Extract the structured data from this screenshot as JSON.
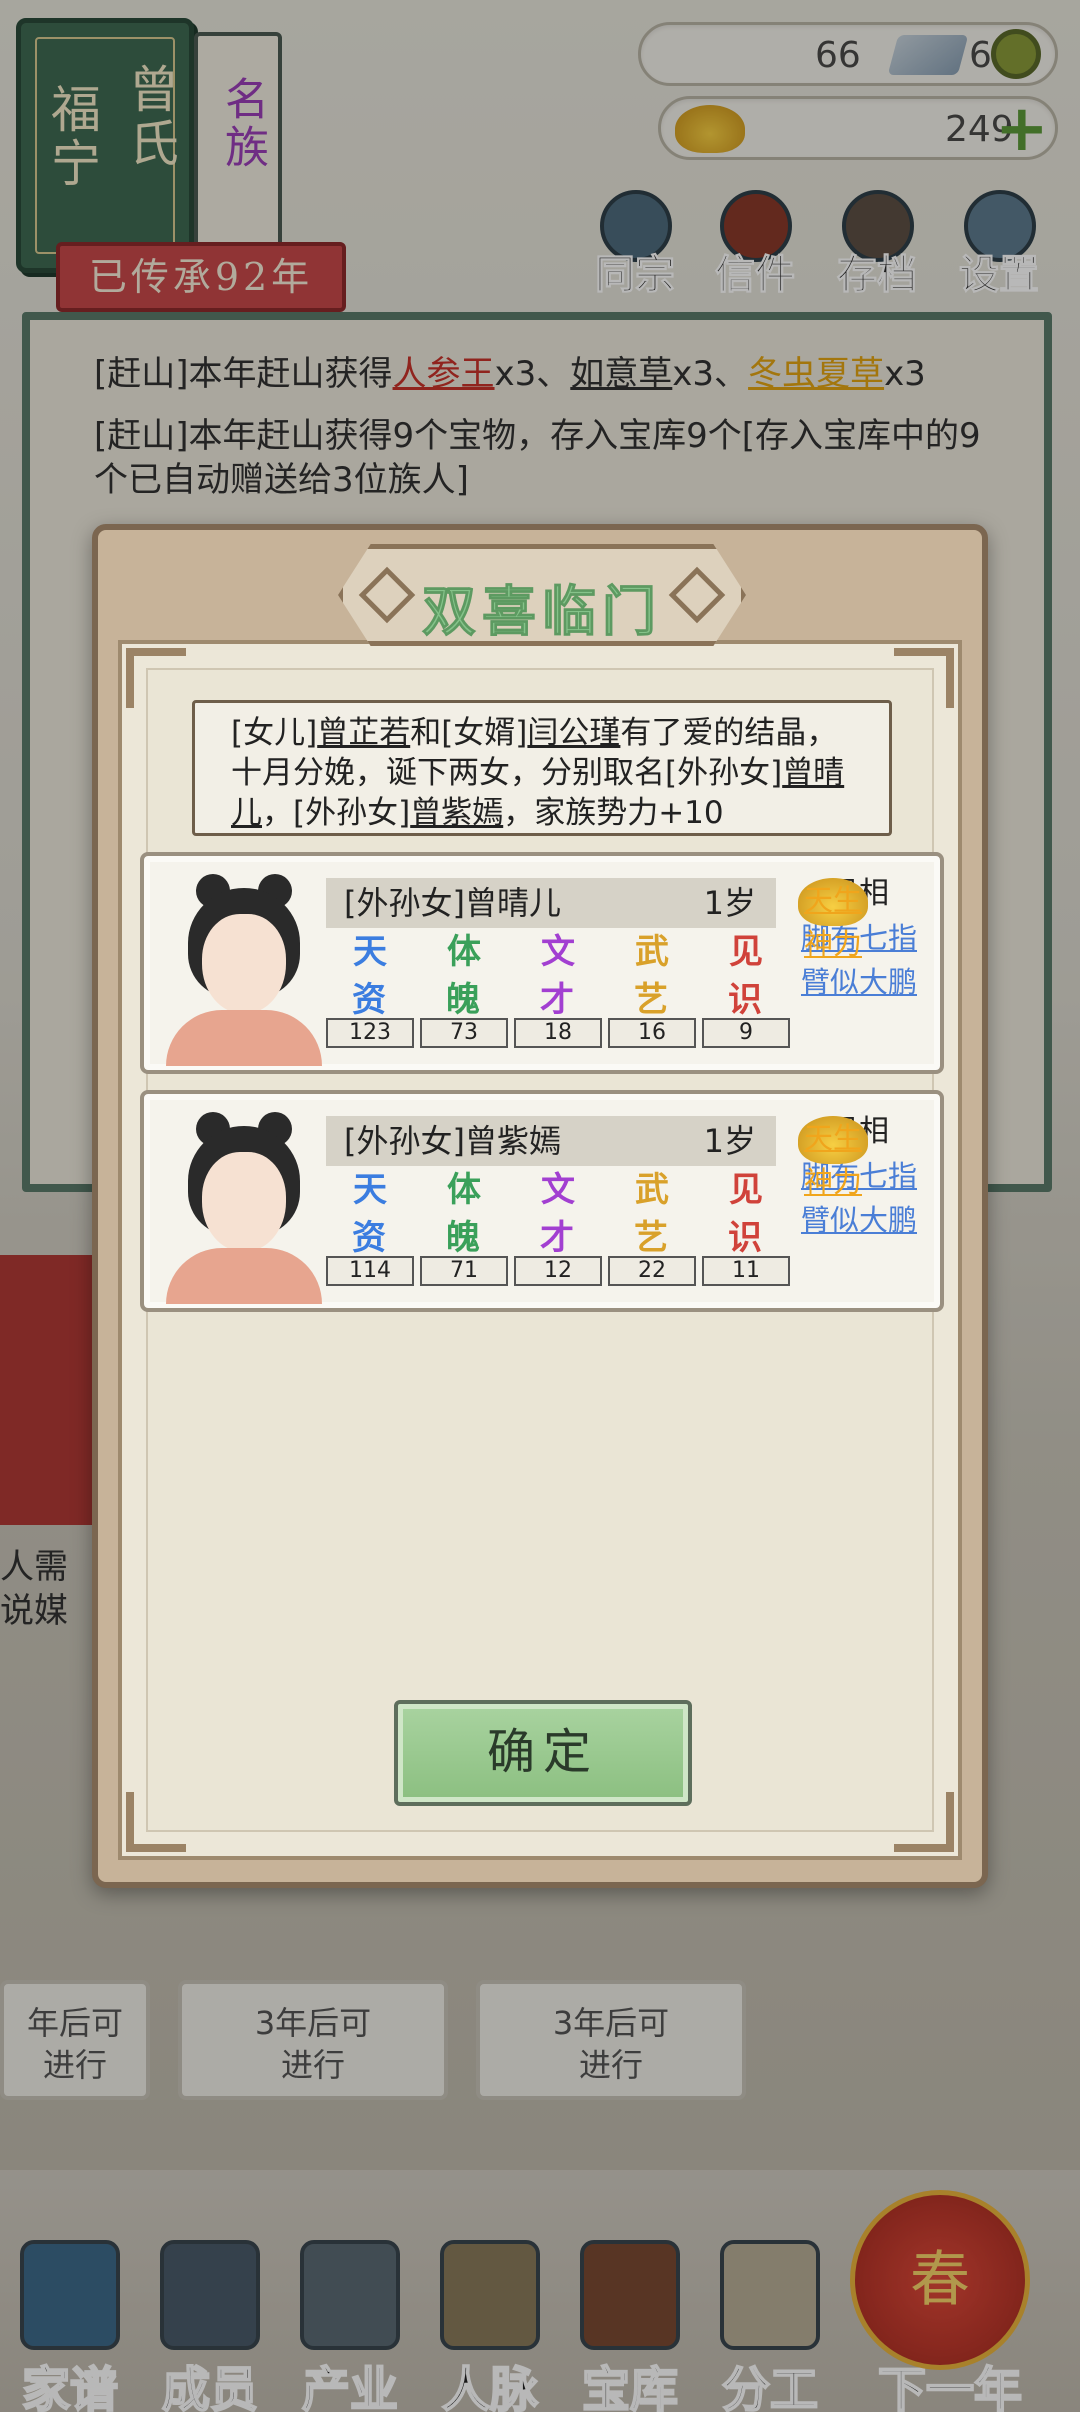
{
  "family": {
    "place": "福宁",
    "surname": "曾氏",
    "rank": "名族",
    "heritage": "已传承92年"
  },
  "currency": {
    "silver": "66",
    "coins": "691",
    "gold": "249"
  },
  "top_buttons": [
    "同宗",
    "信件",
    "存档",
    "设置"
  ],
  "log": {
    "line1_prefix": "[赶山]本年赶山获得",
    "line1_item1": "人参王",
    "line1_sep1": "x3、",
    "line1_item2": "如意草",
    "line1_sep2": "x3、",
    "line1_item3": "冬虫夏草",
    "line1_sep3": "x3",
    "line2": "[赶山]本年赶山获得9个宝物，存入宝库9个[存入宝库中的9个已自动赠送给3位族人]"
  },
  "background": {
    "left_text": "人需\n说媒",
    "card1": "年后可\n进行",
    "card2": "3年后可\n进行",
    "card3": "3年后可\n进行"
  },
  "bottom_nav": [
    "家谱",
    "成员",
    "产业",
    "人脉",
    "宝库",
    "分工",
    "下一年"
  ],
  "spring_label": "春",
  "modal": {
    "title": "双喜临门",
    "message": {
      "p1": "[女儿]",
      "mother": "曾芷若",
      "p2": "和[女婿]",
      "father": "闫公瑾",
      "p3": "有了爱的结晶，十月分娩，诞下两女，分别取名[外孙女]",
      "child1": "曾晴儿",
      "p4": "，[外孙女]",
      "child2": "曾紫嫣",
      "p5": "，家族势力+10"
    },
    "confirm_label": "确定",
    "children": [
      {
        "title": "[外孙女]曾晴儿",
        "age": "1岁",
        "stats": {
          "tianzi": "123",
          "tipo": "73",
          "wencai": "18",
          "wuyi": "16",
          "jianshi": "9"
        },
        "traits_header": "异相",
        "traits": [
          "脚有七指",
          "臂似大鹏",
          "天生神力"
        ]
      },
      {
        "title": "[外孙女]曾紫嫣",
        "age": "1岁",
        "stats": {
          "tianzi": "114",
          "tipo": "71",
          "wencai": "12",
          "wuyi": "22",
          "jianshi": "11"
        },
        "traits_header": "异相",
        "traits": [
          "脚有七指",
          "臂似大鹏",
          "天生神力"
        ]
      }
    ],
    "stat_glyphs": {
      "tianzi": [
        "天",
        "资"
      ],
      "tipo": [
        "体",
        "魄"
      ],
      "wencai": [
        "文",
        "才"
      ],
      "wuyi": [
        "武",
        "艺"
      ],
      "jianshi": [
        "见",
        "识"
      ]
    }
  },
  "colors": {
    "tianzi": "#3b7de0",
    "tipo": "#3aa05a",
    "wencai": "#a23fd1",
    "wuyi": "#d9a12a",
    "jianshi": "#d0423a"
  }
}
